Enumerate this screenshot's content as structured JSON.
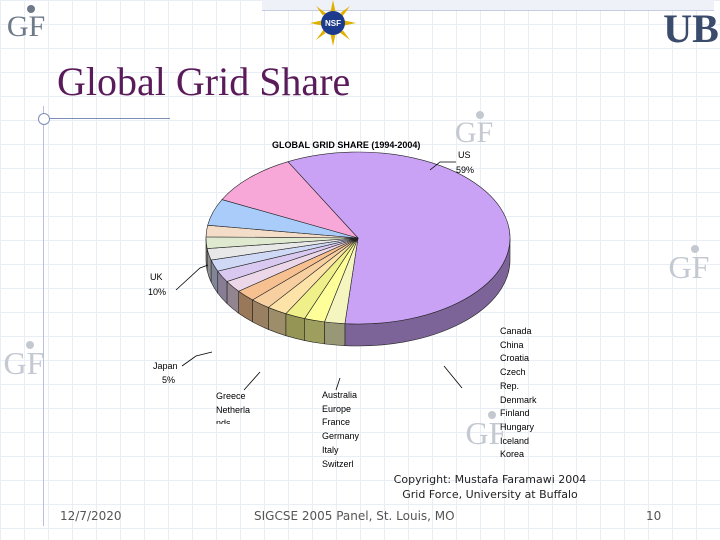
{
  "slide": {
    "title": "Global Grid Share",
    "copyright_line1": "Copyright: Mustafa Faramawi 2004",
    "copyright_line2": "Grid Force, University at Buffalo",
    "footer_date": "12/7/2020",
    "footer_center": "SIGCSE 2005 Panel, St. Louis, MO",
    "footer_page": "10"
  },
  "logos": {
    "gf": "GF",
    "nsf": "NSF",
    "ub": "UB"
  },
  "colors": {
    "title": "#5a1b5a",
    "gf_logo": "#6e7a8a",
    "us_slice": "#c9a2f5",
    "uk_slice": "#f7a8d8",
    "japan_slice": "#a9ccfa"
  },
  "chart_data": {
    "type": "pie",
    "title": "GLOBAL GRID SHARE (1994-2004)",
    "three_d": true,
    "slices": [
      {
        "label": "US",
        "value": 59
      },
      {
        "label": "UK",
        "value": 10
      },
      {
        "label": "Japan",
        "value": 5
      }
    ],
    "us_value_label": "59%",
    "uk_value_label": "10%",
    "japan_value_label": "5%",
    "other_labels_col1": [
      "Greece",
      "Netherla",
      "nds"
    ],
    "other_labels_col2": [
      "Australia",
      "Europe",
      "France",
      "Germany",
      "Italy",
      "Switzerl"
    ],
    "other_labels_col3": [
      "Canada",
      "China",
      "Croatia",
      "Czech",
      "Rep.",
      "Denmark",
      "Finland",
      "Hungary",
      "Iceland",
      "Korea"
    ]
  }
}
